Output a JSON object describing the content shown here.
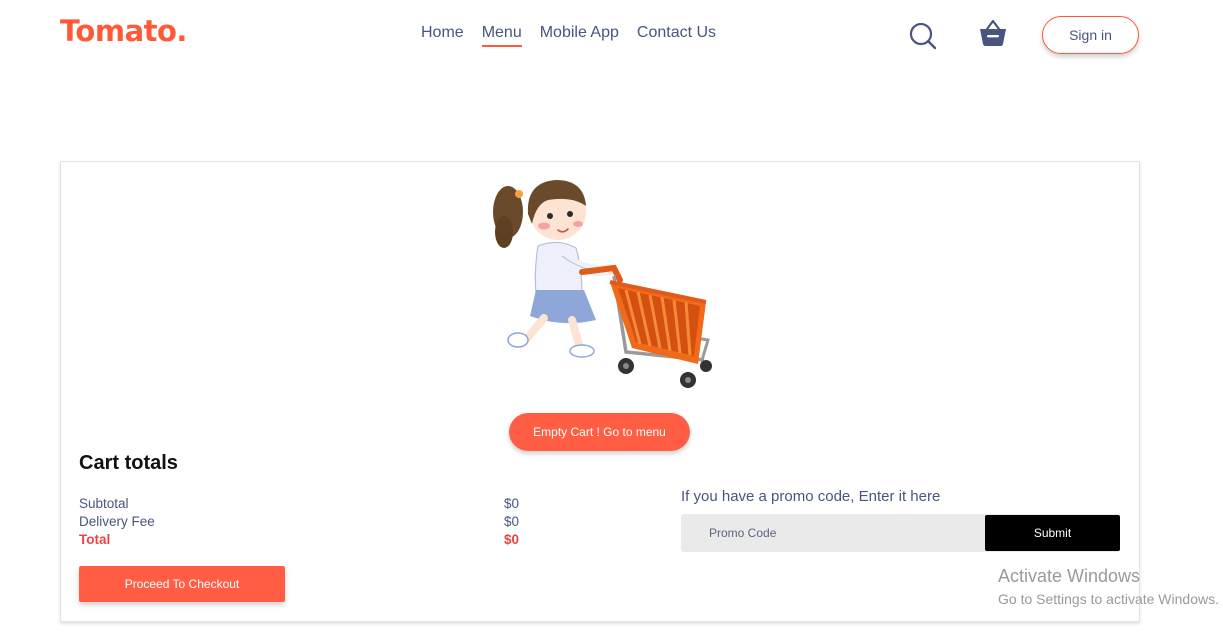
{
  "navbar": {
    "logo": "Tomato.",
    "links": [
      "Home",
      "Menu",
      "Mobile App",
      "Contact Us"
    ],
    "active_link": "Menu",
    "search_icon": "search-icon",
    "basket_icon": "basket-icon",
    "signin_label": "Sign in"
  },
  "cart": {
    "illustration": "girl-pushing-shopping-cart",
    "empty_button_label": "Empty Cart ! Go to menu",
    "totals": {
      "title": "Cart totals",
      "subtotal_label": "Subtotal",
      "subtotal_value": "$0",
      "delivery_label": "Delivery Fee",
      "delivery_value": "$0",
      "total_label": "Total",
      "total_value": "$0",
      "checkout_label": "Proceed To Checkout"
    },
    "promo": {
      "label": "If you have a promo code, Enter it here",
      "placeholder": "Promo Code",
      "submit_label": "Submit"
    }
  },
  "watermark": {
    "title": "Activate Windows",
    "subtitle": "Go to Settings to activate Windows."
  },
  "colors": {
    "accent": "#ff5a38",
    "button": "#ff5e45",
    "total_red": "#e64545",
    "text": "#49557e"
  }
}
